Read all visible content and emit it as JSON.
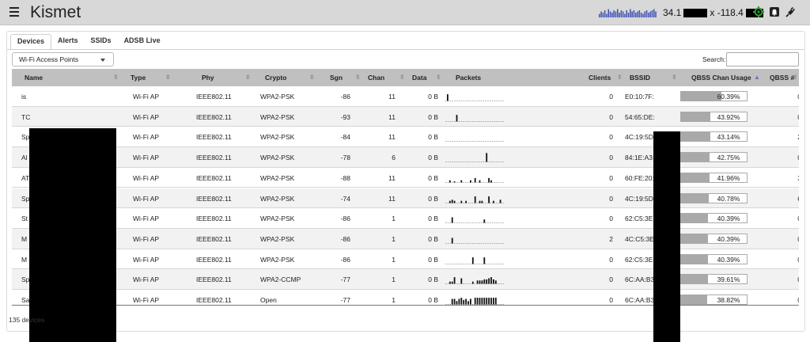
{
  "app": {
    "title": "Kismet"
  },
  "header": {
    "lat_prefix": "34.1",
    "lon_prefix": "x -118.4",
    "sparkline": [
      3,
      5,
      4,
      6,
      3,
      7,
      5,
      4,
      6,
      5,
      7,
      4,
      6,
      5,
      3,
      6,
      4,
      7,
      5,
      6,
      4,
      5,
      6,
      4,
      3,
      5,
      6,
      4,
      5,
      6,
      7,
      5
    ],
    "sparkline_color": "#3f51b5",
    "gps_icon_color": "#2e9d34"
  },
  "tabs": [
    {
      "label": "Devices",
      "active": true
    },
    {
      "label": "Alerts",
      "active": false
    },
    {
      "label": "SSIDs",
      "active": false
    },
    {
      "label": "ADSB Live",
      "active": false
    }
  ],
  "filter": {
    "selected": "Wi-Fi Access Points"
  },
  "search": {
    "label": "Search:",
    "value": ""
  },
  "columns": {
    "name": "Name",
    "type": "Type",
    "phy": "Phy",
    "crypto": "Crypto",
    "sgn": "Sgn",
    "chan": "Chan",
    "data": "Data",
    "packets": "Packets",
    "clients": "Clients",
    "bssid": "BSSID",
    "qbss": "QBSS Chan Usage",
    "qbss_num": "QBSS #"
  },
  "rows": [
    {
      "name": "is",
      "type": "Wi-Fi AP",
      "phy": "IEEE802.11",
      "crypto": "WPA2-PSK",
      "sgn": "-86",
      "chan": "11",
      "data": "0 B",
      "packets": [
        6,
        0,
        0,
        0,
        0,
        0,
        0,
        0,
        0,
        0,
        0,
        0,
        0,
        0,
        0,
        0,
        0,
        0,
        0,
        0,
        0,
        0,
        0,
        0,
        0
      ],
      "clients": "0",
      "bssid": "E0:10:7F:",
      "qbss_pct": 60.39,
      "qbss_label": "60.39%",
      "qbss_num": "0"
    },
    {
      "name": "TC",
      "type": "Wi-Fi AP",
      "phy": "IEEE802.11",
      "crypto": "WPA2-PSK",
      "sgn": "-93",
      "chan": "11",
      "data": "0 B",
      "packets": [
        0,
        0,
        0,
        0,
        6,
        0,
        0,
        0,
        0,
        0,
        0,
        0,
        0,
        0,
        0,
        0,
        0,
        0,
        0,
        0,
        0,
        0,
        0,
        0,
        0
      ],
      "clients": "0",
      "bssid": "54:65:DE:",
      "qbss_pct": 43.92,
      "qbss_label": "43.92%",
      "qbss_num": "0"
    },
    {
      "name": "Sp",
      "type": "Wi-Fi AP",
      "phy": "IEEE802.11",
      "crypto": "WPA2-PSK",
      "sgn": "-84",
      "chan": "11",
      "data": "0 B",
      "packets": [
        0,
        0,
        0,
        0,
        0,
        0,
        0,
        0,
        0,
        0,
        0,
        0,
        0,
        0,
        0,
        0,
        0,
        0,
        0,
        0,
        0,
        0,
        0,
        0,
        0
      ],
      "clients": "0",
      "bssid": "4C:19:5D:",
      "qbss_pct": 43.14,
      "qbss_label": "43.14%",
      "qbss_num": "2"
    },
    {
      "name": "Al",
      "type": "Wi-Fi AP",
      "phy": "IEEE802.11",
      "crypto": "WPA2-PSK",
      "sgn": "-78",
      "chan": "6",
      "data": "0 B",
      "packets": [
        0,
        0,
        0,
        0,
        0,
        0,
        0,
        0,
        0,
        0,
        0,
        0,
        0,
        0,
        0,
        0,
        0,
        8,
        0,
        0,
        0,
        0,
        0,
        0,
        0
      ],
      "clients": "0",
      "bssid": "84:1E:A3:",
      "qbss_pct": 42.75,
      "qbss_label": "42.75%",
      "qbss_num": "0"
    },
    {
      "name": "AT",
      "type": "Wi-Fi AP",
      "phy": "IEEE802.11",
      "crypto": "WPA2-PSK",
      "sgn": "-88",
      "chan": "11",
      "data": "0 B",
      "packets": [
        0,
        2,
        0,
        1,
        0,
        0,
        2,
        0,
        0,
        0,
        2,
        0,
        4,
        0,
        2,
        0,
        0,
        0,
        4,
        2,
        0,
        0,
        0,
        0,
        0
      ],
      "clients": "0",
      "bssid": "60:FE:20:",
      "qbss_pct": 41.96,
      "qbss_label": "41.96%",
      "qbss_num": "3"
    },
    {
      "name": "Sp",
      "type": "Wi-Fi AP",
      "phy": "IEEE802.11",
      "crypto": "WPA2-PSK",
      "sgn": "-74",
      "chan": "11",
      "data": "0 B",
      "packets": [
        0,
        2,
        3,
        2,
        0,
        0,
        2,
        0,
        2,
        0,
        0,
        0,
        6,
        0,
        2,
        2,
        0,
        0,
        6,
        0,
        2,
        0,
        0,
        3,
        0
      ],
      "clients": "0",
      "bssid": "4C:19:5D:",
      "qbss_pct": 40.78,
      "qbss_label": "40.78%",
      "qbss_num": "6"
    },
    {
      "name": "St",
      "type": "Wi-Fi AP",
      "phy": "IEEE802.11",
      "crypto": "WPA2-PSK",
      "sgn": "-86",
      "chan": "1",
      "data": "0 B",
      "packets": [
        0,
        0,
        5,
        0,
        0,
        0,
        0,
        0,
        0,
        0,
        0,
        0,
        0,
        0,
        0,
        0,
        3,
        0,
        0,
        0,
        0,
        0,
        0,
        0,
        0
      ],
      "clients": "0",
      "bssid": "62:C5:3E:",
      "qbss_pct": 40.39,
      "qbss_label": "40.39%",
      "qbss_num": "0"
    },
    {
      "name": "M",
      "type": "Wi-Fi AP",
      "phy": "IEEE802.11",
      "crypto": "WPA2-PSK",
      "sgn": "-86",
      "chan": "1",
      "data": "0 B",
      "packets": [
        0,
        0,
        5,
        0,
        0,
        0,
        0,
        0,
        0,
        0,
        0,
        0,
        0,
        0,
        0,
        0,
        0,
        0,
        0,
        0,
        0,
        0,
        0,
        0,
        0
      ],
      "clients": "2",
      "bssid": "4C:C5:3E:",
      "qbss_pct": 40.39,
      "qbss_label": "40.39%",
      "qbss_num": "0"
    },
    {
      "name": "M",
      "type": "Wi-Fi AP",
      "phy": "IEEE802.11",
      "crypto": "WPA2-PSK",
      "sgn": "-86",
      "chan": "1",
      "data": "0 B",
      "packets": [
        0,
        0,
        0,
        0,
        0,
        0,
        0,
        0,
        0,
        0,
        0,
        6,
        0,
        0,
        0,
        0,
        6,
        0,
        0,
        0,
        0,
        0,
        0,
        0,
        0
      ],
      "clients": "0",
      "bssid": "62:C5:3E:",
      "qbss_pct": 40.39,
      "qbss_label": "40.39%",
      "qbss_num": "0"
    },
    {
      "name": "Sp",
      "type": "Wi-Fi AP",
      "phy": "IEEE802.11",
      "crypto": "WPA2-CCMP",
      "sgn": "-77",
      "chan": "1",
      "data": "0 B",
      "packets": [
        0,
        2,
        2,
        6,
        0,
        0,
        5,
        0,
        0,
        0,
        0,
        2,
        0,
        3,
        3,
        3,
        4,
        4,
        5,
        6,
        4,
        3,
        0,
        0,
        0
      ],
      "clients": "0",
      "bssid": "6C:AA:B3",
      "qbss_pct": 39.61,
      "qbss_label": "39.61%",
      "qbss_num": "0"
    },
    {
      "name": "Sa",
      "type": "Wi-Fi AP",
      "phy": "IEEE802.11",
      "crypto": "Open",
      "sgn": "-77",
      "chan": "1",
      "data": "0 B",
      "packets": [
        0,
        0,
        5,
        5,
        3,
        5,
        6,
        4,
        5,
        3,
        5,
        0,
        6,
        6,
        6,
        6,
        6,
        6,
        6,
        6,
        6,
        6,
        0,
        0,
        0
      ],
      "clients": "0",
      "bssid": "6C:AA:B3",
      "qbss_pct": 38.82,
      "qbss_label": "38.82%",
      "qbss_num": "0"
    }
  ],
  "footer": {
    "count_text": "135 devices"
  }
}
